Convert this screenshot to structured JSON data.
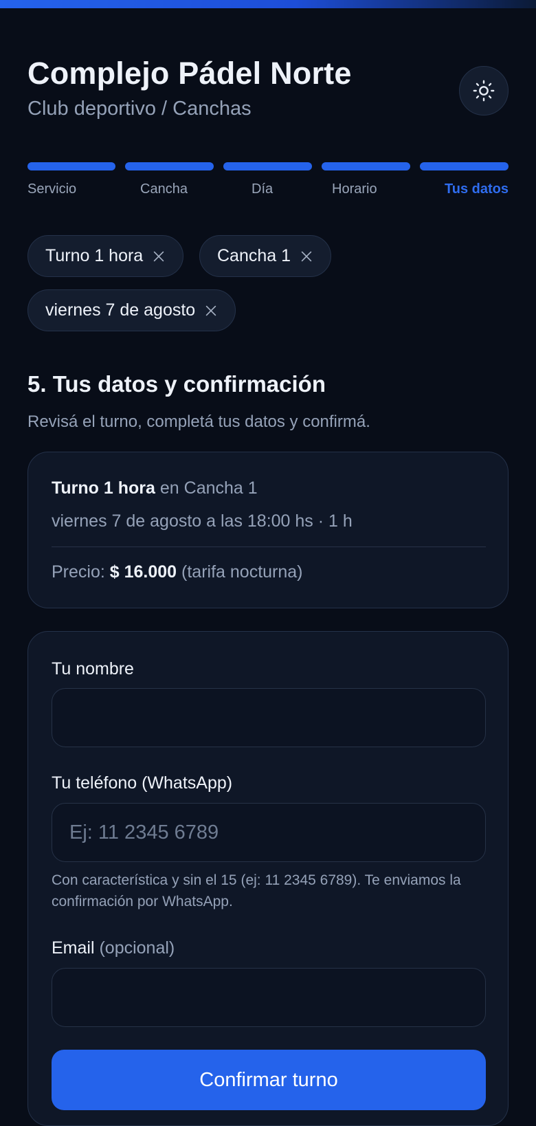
{
  "header": {
    "title": "Complejo Pádel Norte",
    "subtitle": "Club deportivo / Canchas",
    "theme_icon": "sun-icon"
  },
  "stepper": {
    "steps": [
      {
        "label": "Servicio",
        "state": "completed"
      },
      {
        "label": "Cancha",
        "state": "completed"
      },
      {
        "label": "Día",
        "state": "completed"
      },
      {
        "label": "Horario",
        "state": "completed"
      },
      {
        "label": "Tus datos",
        "state": "current"
      }
    ],
    "active_color": "#2563eb"
  },
  "chips": [
    {
      "label": "Turno 1 hora",
      "icon": "close-icon"
    },
    {
      "label": "Cancha 1",
      "icon": "close-icon"
    },
    {
      "label": "viernes 7 de agosto",
      "icon": "close-icon"
    }
  ],
  "section": {
    "title": "5. Tus datos y confirmación",
    "description": "Revisá el turno, completá tus datos y confirmá."
  },
  "summary": {
    "service": "Turno 1 hora",
    "court_prefix": " en ",
    "court": "Cancha 1",
    "when": "viernes 7 de agosto a las 18:00 hs · 1 h",
    "price_prefix": "Precio: ",
    "price": "$ 16.000",
    "price_note": " (tarifa nocturna)"
  },
  "form": {
    "name": {
      "label": "Tu nombre",
      "value": "",
      "placeholder": ""
    },
    "phone": {
      "label": "Tu teléfono (WhatsApp)",
      "value": "",
      "placeholder": "Ej: 11 2345 6789",
      "help": "Con característica y sin el 15 (ej: 11 2345 6789). Te enviamos la confirmación por WhatsApp."
    },
    "email": {
      "label": "Email",
      "optional": " (opcional)",
      "value": "",
      "placeholder": ""
    },
    "submit_label": "Confirmar turno"
  },
  "colors": {
    "background": "#080d18",
    "card": "#0f1727",
    "accent": "#2563eb",
    "muted_text": "#95a2b8"
  }
}
